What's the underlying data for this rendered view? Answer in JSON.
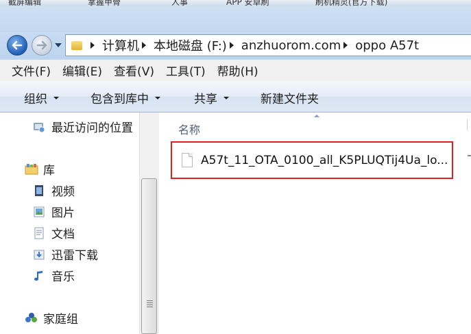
{
  "taskbar": {
    "items": [
      "截屏编辑",
      "掌握甲骨",
      "人事",
      "APP 安卓刷",
      "刷机精灵(官方下载)"
    ]
  },
  "navigation": {
    "back_icon": "back-arrow-icon",
    "forward_icon": "forward-arrow-icon",
    "breadcrumbs": [
      "计算机",
      "本地磁盘 (F:)",
      "anzhuorom.com",
      "oppo A57t"
    ]
  },
  "menu": {
    "items": [
      "文件(F)",
      "编辑(E)",
      "查看(V)",
      "工具(T)",
      "帮助(H)"
    ]
  },
  "commands": {
    "organize": "组织",
    "include_library": "包含到库中",
    "share": "共享",
    "new_folder": "新建文件夹"
  },
  "sidebar": {
    "items": [
      {
        "label": "最近访问的位置",
        "icon": "recent-places-icon"
      },
      {
        "label": "库",
        "icon": "library-icon"
      },
      {
        "label": "视频",
        "icon": "video-icon"
      },
      {
        "label": "图片",
        "icon": "pictures-icon"
      },
      {
        "label": "文档",
        "icon": "documents-icon"
      },
      {
        "label": "迅雷下载",
        "icon": "download-folder-icon"
      },
      {
        "label": "音乐",
        "icon": "music-icon"
      },
      {
        "label": "家庭组",
        "icon": "homegroup-icon"
      }
    ]
  },
  "filelist": {
    "column_name": "名称",
    "files": [
      {
        "name": "A57t_11_OTA_0100_all_K5PLUQTij4Ua_lo...",
        "icon": "file-icon"
      }
    ]
  },
  "colors": {
    "highlight_border": "#e02020",
    "address_border": "#7f9db9"
  }
}
